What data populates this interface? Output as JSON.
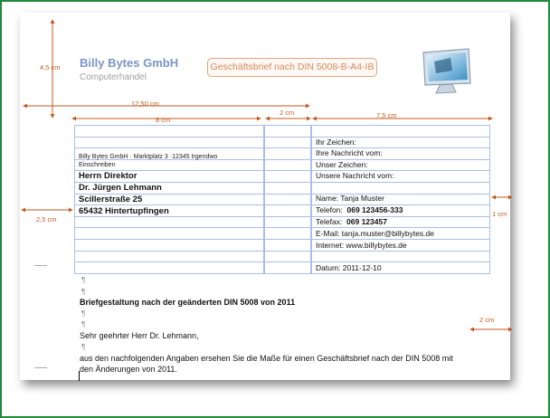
{
  "company": {
    "name": "Billy Bytes GmbH",
    "subtitle": "Computerhandel"
  },
  "doc_title": "Geschäftsbrief nach DIN 5008-B-A4-IB",
  "dimensions": {
    "top_margin": "4,5 cm",
    "address_width": "12,50 cm",
    "field_width": "8 cm",
    "gap": "2 cm",
    "info_width": "7,5 cm",
    "left_margin": "2,5 cm",
    "right_margin": "1 cm",
    "bottom_gap": "2 cm"
  },
  "sender_line": "Billy Bytes GmbH · Marktplatz 3 ·12345 Irgendwo",
  "shipping": "Einschreiben",
  "recipient": [
    "Herrn Direktor",
    "Dr. Jürgen Lehmann",
    "Scillerstraße  25",
    "65432 Hintertupfingen"
  ],
  "info_block": {
    "ihr_zeichen": "Ihr Zeichen:",
    "ihre_nachricht": "Ihre Nachricht vom:",
    "unser_zeichen": "Unser Zeichen:",
    "unsere_nachricht": "Unsere Nachricht  vom:",
    "name": "Name: Tanja Muster",
    "telefon_label": "Telefon:",
    "telefon_value": "069 123456-333",
    "telefax_label": "Telefax:",
    "telefax_value": "069 123457",
    "email": "E-Mail:  tanja.muster@billybytes.de",
    "internet": "Internet:  www.billybytes.de",
    "datum": "Datum: 2011-12-10"
  },
  "pilcrow": "¶",
  "letter": {
    "subject": "Briefgestaltung nach der geänderten DIN 5008 von 2011",
    "salutation": "Sehr geehrter  Herr Dr. Lehmann,",
    "body_line1": "aus den nachfolgenden Angaben ersehen Sie die Maße für einen Geschäftsbrief  nach der DIN 5008 mit",
    "body_line2": "den Änderungen von 2011."
  },
  "colors": {
    "frame": "#1f8a3c",
    "dimension": "#c05a21",
    "grid": "#a9bfe3",
    "brand": "#7a95c8"
  }
}
